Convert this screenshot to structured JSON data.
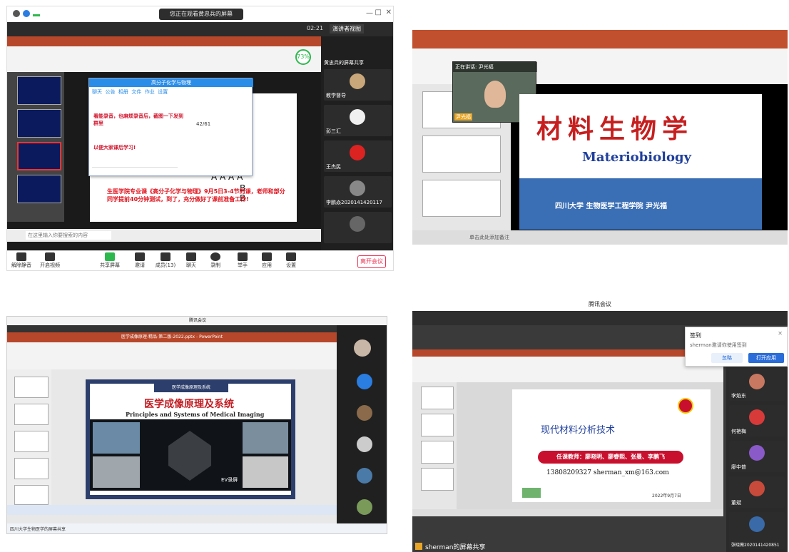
{
  "panel1": {
    "share_banner": "您正在观看黄忠兵的屏幕",
    "timer": "02:21",
    "view_mode": "演讲者视图",
    "sharer_label": "黄忠兵的屏幕共享",
    "participants": [
      "教学督导",
      "彭三汇",
      "王杰民",
      "李鹏焱2020141420117"
    ],
    "chat_title": "高分子化学与物理",
    "chat_tabs": [
      "聊天",
      "公告",
      "相册",
      "文件",
      "作业",
      "设置"
    ],
    "chat_msg1": "看能录音，也麻烦录音后，截图一下发到群里",
    "chat_msg2": "以便大家课后学习!",
    "notice": "生医学院专业课《高分子化学与物理》9月5日3-4节的课，老师和部分同学提前40分钟测试，到了，充分做好了课前准备工作!",
    "progress_badge": "73%",
    "slide_text": [
      "A A A A",
      "B",
      "B"
    ],
    "page_count": "42/61",
    "search_placeholder": "在这里输入你要搜索的内容",
    "toolbar": {
      "mute": "解除静音",
      "video": "开启视频",
      "share": "共享屏幕",
      "invite": "邀请",
      "members": "成员(13)",
      "chat": "聊天",
      "record": "录制",
      "raise": "举手",
      "apps": "应用",
      "settings": "设置",
      "leave": "离开会议"
    }
  },
  "panel2": {
    "speaker": "正在讲话: 尹光福",
    "speaker_name": "尹光福",
    "title_cn": "材料生物学",
    "title_en": "Materiobiology",
    "footer": "四川大学 生物医学工程学院 尹光福",
    "notes_hint": "单击此处添加备注"
  },
  "panel3": {
    "title_bar": "腾讯会议",
    "ppt_title": "医学成像原理-精品-第二版-2022.pptx - PowerPoint",
    "slide_banner": "医学成像原理及系统",
    "title_cn": "医学成像原理及系统",
    "title_en": "Principles and Systems of Medical Imaging",
    "watermark": "EV录屏",
    "sharer": "四川大学生物医学的屏幕共享"
  },
  "panel4": {
    "title_bar": "腾讯会议",
    "signin_title": "签到",
    "signin_msg": "sherman邀请你使用签到",
    "ignore_button": "忽略",
    "open_button": "打开应用",
    "slide_title": "现代材料分析技术",
    "teachers": "任课教师：廖晓明、廖睿熙、张曼、李鹏飞",
    "contact": "13808209327  sherman_xm@163.com",
    "date": "2022年9月7日",
    "participants": [
      "李焰东",
      "何艳梅",
      "廖中普",
      "董斌",
      "张晓薇2020141420851"
    ],
    "sharer": "sherman的屏幕共享"
  }
}
